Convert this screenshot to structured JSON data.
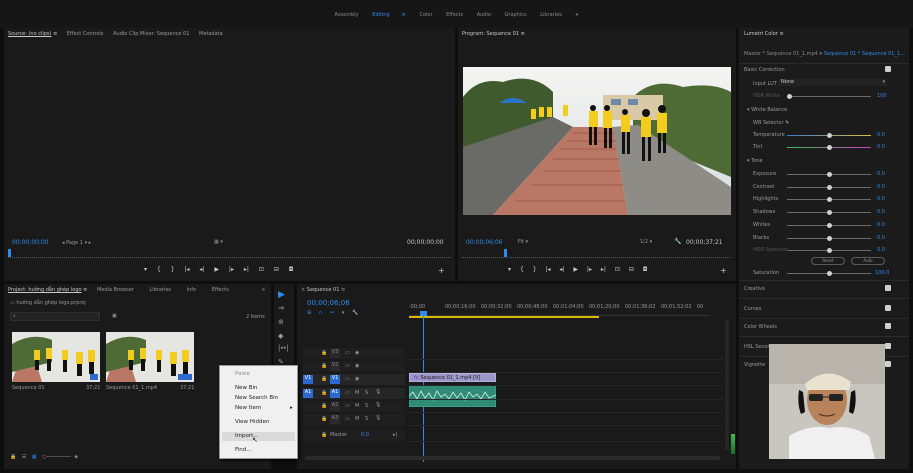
{
  "workspaces": {
    "items": [
      "Assembly",
      "Editing",
      "Color",
      "Effects",
      "Audio",
      "Graphics",
      "Libraries"
    ],
    "active": "Editing",
    "more": "»"
  },
  "source": {
    "tabs": [
      "Source: (no clips)",
      "Effect Controls",
      "Audio Clip Mixer: Sequence 01",
      "Metadata"
    ],
    "timecode_left": "00;00;00;00",
    "page": "Page 1",
    "timecode_right": "00;00;00;00"
  },
  "program": {
    "tab": "Program: Sequence 01",
    "timecode_left": "00;00;06;06",
    "fit": "Fit",
    "resolution": "1/2",
    "timecode_right": "00;00;37;21"
  },
  "lumetri": {
    "title": "Lumetri Color",
    "master": "Master * Sequence 01_1.mp4",
    "seq": "Sequence 01 * Sequence 01_1...",
    "basic": "Basic Correction",
    "input_lut_label": "Input LUT",
    "input_lut_value": "None",
    "hdr_white": "HDR White",
    "hdr_white_val": "100",
    "white_balance": "White Balance",
    "wb_selector": "WB Selector",
    "temperature": "Temperature",
    "temperature_val": "0.0",
    "tint": "Tint",
    "tint_val": "0.0",
    "tone": "Tone",
    "tone_items": [
      {
        "label": "Exposure",
        "val": "0.0"
      },
      {
        "label": "Contrast",
        "val": "0.0"
      },
      {
        "label": "Highlights",
        "val": "0.0"
      },
      {
        "label": "Shadows",
        "val": "0.0"
      },
      {
        "label": "Whites",
        "val": "0.0"
      },
      {
        "label": "Blacks",
        "val": "0.0"
      },
      {
        "label": "HDR Specular",
        "val": "0.0"
      }
    ],
    "reset": "Reset",
    "auto": "Auto",
    "saturation": "Saturation",
    "saturation_val": "100.0",
    "sections": [
      "Creative",
      "Curves",
      "Color Wheels",
      "HSL Second",
      "Vignette"
    ]
  },
  "project": {
    "tabs": [
      "Project: hướng dẫn ghép logo",
      "Media Browser",
      "Libraries",
      "Info",
      "Effects"
    ],
    "more": "»",
    "path": "hướng dẫn ghép logo.prproj",
    "items_count": "2 Items",
    "clips": [
      {
        "name": "Sequence 01",
        "duration": "37;21"
      },
      {
        "name": "Sequence 01_1.mp4",
        "duration": "37;21"
      }
    ]
  },
  "context_menu": {
    "items": [
      "Paste",
      "New Bin",
      "New Search Bin",
      "New Item",
      "View Hidden",
      "Import...",
      "Find..."
    ],
    "highlighted": "Import..."
  },
  "timeline": {
    "tab": "Sequence 01",
    "timecode": "00;00;06;06",
    "ruler": [
      ":00;00",
      "00;00;16;00",
      "00;00;32;00",
      "00;00;48;00",
      "00;01;04;00",
      "00;01;20;00",
      "00;01;36;02",
      "00;01;52;02",
      "00"
    ],
    "tracks": [
      "V3",
      "V2",
      "V1",
      "A1",
      "A2",
      "A3",
      "Master"
    ],
    "master_val": "0.0",
    "v1_source": "V1",
    "a1_source": "A1",
    "clip_name": "Sequence 01_1.mp4 [V]"
  }
}
